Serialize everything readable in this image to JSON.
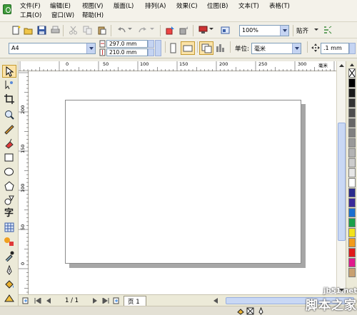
{
  "menu": {
    "row1": [
      "文件(F)",
      "编辑(E)",
      "视图(V)",
      "版面(L)",
      "排列(A)",
      "效果(C)",
      "位图(B)",
      "文本(T)",
      "表格(T)"
    ],
    "row2": [
      "工具(O)",
      "窗口(W)",
      "帮助(H)"
    ]
  },
  "toolbar": {
    "zoom_value": "100%",
    "snap_label": "贴齐"
  },
  "property_bar": {
    "paper_size": "A4",
    "width_value": "297.0 mm",
    "height_value": "210.0 mm",
    "units_label": "单位:",
    "units_value": "毫米",
    "nudge_value": ".1 mm"
  },
  "rulers": {
    "horizontal": [
      "0",
      "50",
      "100",
      "150",
      "200",
      "250",
      "300"
    ],
    "horizontal_unit": "毫米",
    "vertical": [
      "200",
      "150",
      "100",
      "50",
      "0"
    ]
  },
  "page_nav": {
    "page_count": "1 / 1",
    "page_tab": "页 1"
  },
  "watermark": {
    "line1": "jb51.net",
    "line2": "脚本之家"
  },
  "palette_colors": [
    "#000000",
    "#1a1a1a",
    "#333333",
    "#4d4d4d",
    "#666666",
    "#808080",
    "#999999",
    "#b3b3b3",
    "#cccccc",
    "#e6e6e6",
    "#ffffff",
    "#2b2b8c",
    "#3a2a9a",
    "#1a6fd0",
    "#1aa04a",
    "#f2e21a",
    "#f29a1a",
    "#e01a1a",
    "#e01a8c",
    "#c8a070"
  ]
}
